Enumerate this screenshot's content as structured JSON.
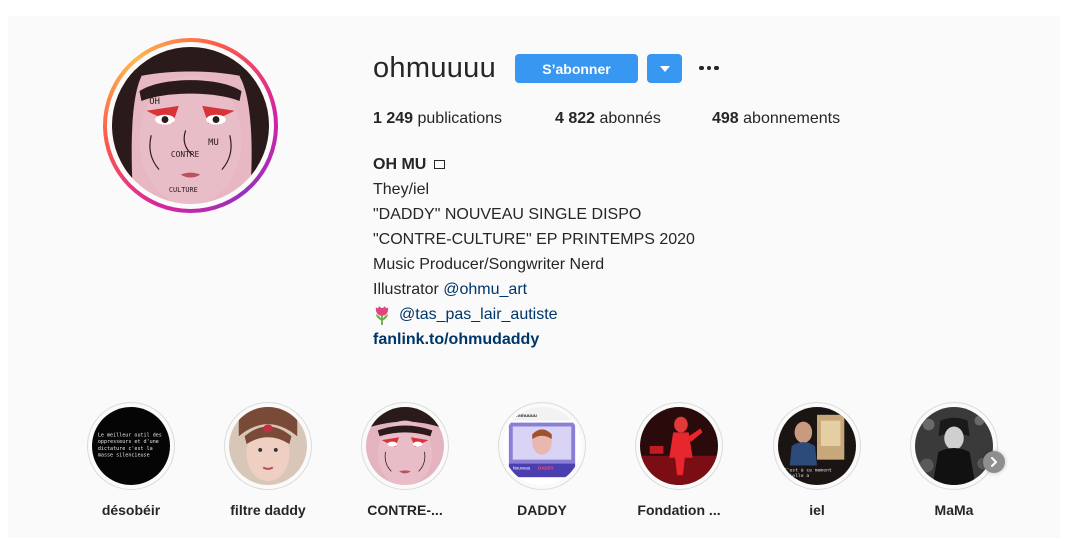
{
  "profile": {
    "username": "ohmuuuu",
    "follow_label": "S’abonner",
    "avatar_text": [
      "OH",
      "MU",
      "CONTRE",
      "CULTURE"
    ]
  },
  "stats": {
    "posts_count": "1 249",
    "posts_label": "publications",
    "followers_count": "4 822",
    "followers_label": "abonnés",
    "following_count": "498",
    "following_label": "abonnements"
  },
  "bio": {
    "name": "OH MU",
    "pronouns": "They/iel",
    "line1": "\"DADDY\" NOUVEAU SINGLE DISPO",
    "line2": "\"CONTRE-CULTURE\" EP PRINTEMPS 2020",
    "line3": "Music Producer/Songwriter Nerd",
    "illustrator_prefix": "Illustrator ",
    "illustrator_handle": "@ohmu_art",
    "flower_handle": "@tas_pas_lair_autiste",
    "website": "fanlink.to/ohmudaddy"
  },
  "highlights": [
    {
      "label": "désobéir",
      "cover_text": [
        "Le meilleur outil des",
        "oppresseurs et d'une",
        "dictature c'est la",
        "masse silencieuse"
      ]
    },
    {
      "label": "filtre daddy"
    },
    {
      "label": "CONTRE-..."
    },
    {
      "label": "DADDY",
      "cover_text": [
        "ohmuuuu",
        "Nouveau",
        "DADDY"
      ]
    },
    {
      "label": "Fondation ..."
    },
    {
      "label": "iel",
      "cover_text": [
        "C'est à ce moment",
        "qu'elle a"
      ]
    },
    {
      "label": "MaMa"
    }
  ],
  "colors": {
    "accent": "#3897f0",
    "link": "#003569",
    "text": "#262626",
    "background": "#fafafa"
  }
}
